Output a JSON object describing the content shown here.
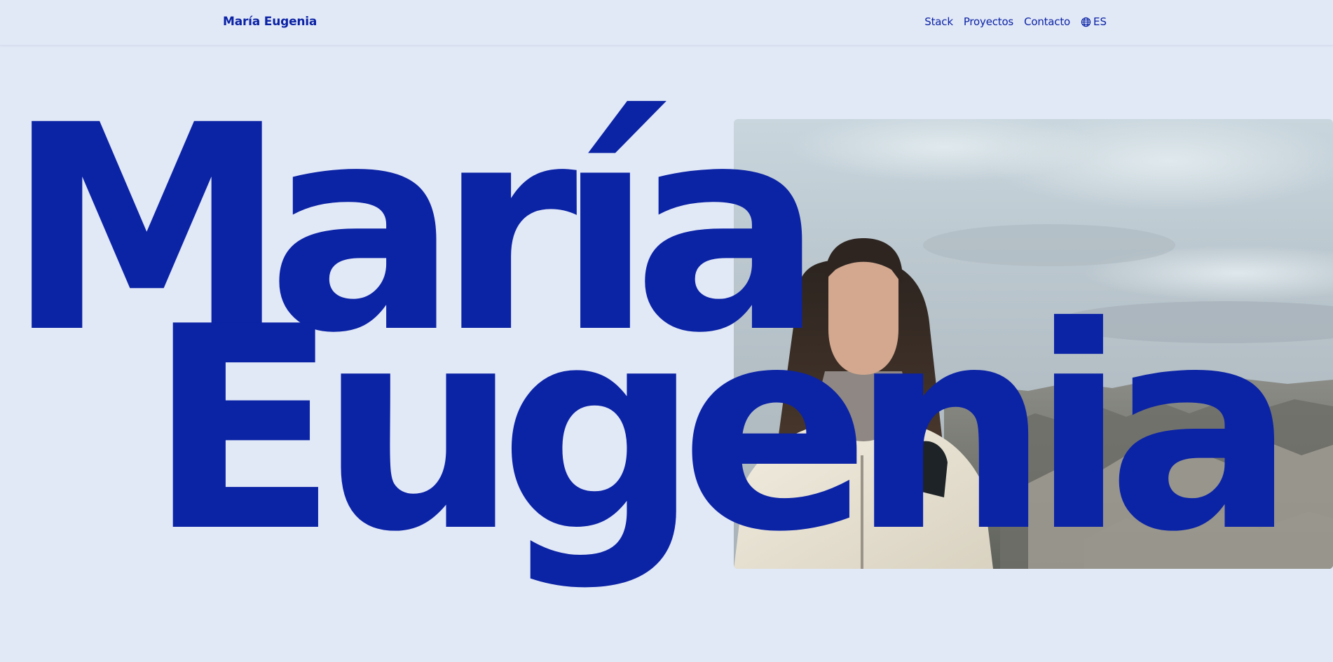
{
  "header": {
    "brand": "María Eugenia",
    "nav": {
      "stack": "Stack",
      "projects": "Proyectos",
      "contact": "Contacto"
    },
    "language": {
      "icon": "globe-icon",
      "label": "ES"
    }
  },
  "hero": {
    "first_name": "María",
    "second_name": "Eugenia",
    "photo": "portrait-photo"
  },
  "colors": {
    "accent": "#0b23a5",
    "background": "#e1e8f6"
  }
}
